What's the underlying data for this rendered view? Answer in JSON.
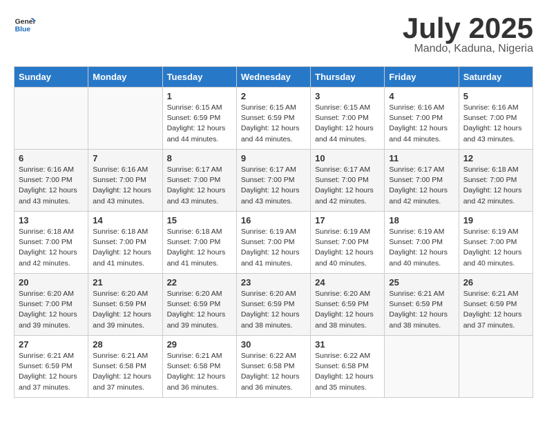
{
  "header": {
    "logo_general": "General",
    "logo_blue": "Blue",
    "month": "July 2025",
    "location": "Mando, Kaduna, Nigeria"
  },
  "days_of_week": [
    "Sunday",
    "Monday",
    "Tuesday",
    "Wednesday",
    "Thursday",
    "Friday",
    "Saturday"
  ],
  "weeks": [
    [
      {
        "day": "",
        "info": ""
      },
      {
        "day": "",
        "info": ""
      },
      {
        "day": "1",
        "info": "Sunrise: 6:15 AM\nSunset: 6:59 PM\nDaylight: 12 hours and 44 minutes."
      },
      {
        "day": "2",
        "info": "Sunrise: 6:15 AM\nSunset: 6:59 PM\nDaylight: 12 hours and 44 minutes."
      },
      {
        "day": "3",
        "info": "Sunrise: 6:15 AM\nSunset: 7:00 PM\nDaylight: 12 hours and 44 minutes."
      },
      {
        "day": "4",
        "info": "Sunrise: 6:16 AM\nSunset: 7:00 PM\nDaylight: 12 hours and 44 minutes."
      },
      {
        "day": "5",
        "info": "Sunrise: 6:16 AM\nSunset: 7:00 PM\nDaylight: 12 hours and 43 minutes."
      }
    ],
    [
      {
        "day": "6",
        "info": "Sunrise: 6:16 AM\nSunset: 7:00 PM\nDaylight: 12 hours and 43 minutes."
      },
      {
        "day": "7",
        "info": "Sunrise: 6:16 AM\nSunset: 7:00 PM\nDaylight: 12 hours and 43 minutes."
      },
      {
        "day": "8",
        "info": "Sunrise: 6:17 AM\nSunset: 7:00 PM\nDaylight: 12 hours and 43 minutes."
      },
      {
        "day": "9",
        "info": "Sunrise: 6:17 AM\nSunset: 7:00 PM\nDaylight: 12 hours and 43 minutes."
      },
      {
        "day": "10",
        "info": "Sunrise: 6:17 AM\nSunset: 7:00 PM\nDaylight: 12 hours and 42 minutes."
      },
      {
        "day": "11",
        "info": "Sunrise: 6:17 AM\nSunset: 7:00 PM\nDaylight: 12 hours and 42 minutes."
      },
      {
        "day": "12",
        "info": "Sunrise: 6:18 AM\nSunset: 7:00 PM\nDaylight: 12 hours and 42 minutes."
      }
    ],
    [
      {
        "day": "13",
        "info": "Sunrise: 6:18 AM\nSunset: 7:00 PM\nDaylight: 12 hours and 42 minutes."
      },
      {
        "day": "14",
        "info": "Sunrise: 6:18 AM\nSunset: 7:00 PM\nDaylight: 12 hours and 41 minutes."
      },
      {
        "day": "15",
        "info": "Sunrise: 6:18 AM\nSunset: 7:00 PM\nDaylight: 12 hours and 41 minutes."
      },
      {
        "day": "16",
        "info": "Sunrise: 6:19 AM\nSunset: 7:00 PM\nDaylight: 12 hours and 41 minutes."
      },
      {
        "day": "17",
        "info": "Sunrise: 6:19 AM\nSunset: 7:00 PM\nDaylight: 12 hours and 40 minutes."
      },
      {
        "day": "18",
        "info": "Sunrise: 6:19 AM\nSunset: 7:00 PM\nDaylight: 12 hours and 40 minutes."
      },
      {
        "day": "19",
        "info": "Sunrise: 6:19 AM\nSunset: 7:00 PM\nDaylight: 12 hours and 40 minutes."
      }
    ],
    [
      {
        "day": "20",
        "info": "Sunrise: 6:20 AM\nSunset: 7:00 PM\nDaylight: 12 hours and 39 minutes."
      },
      {
        "day": "21",
        "info": "Sunrise: 6:20 AM\nSunset: 6:59 PM\nDaylight: 12 hours and 39 minutes."
      },
      {
        "day": "22",
        "info": "Sunrise: 6:20 AM\nSunset: 6:59 PM\nDaylight: 12 hours and 39 minutes."
      },
      {
        "day": "23",
        "info": "Sunrise: 6:20 AM\nSunset: 6:59 PM\nDaylight: 12 hours and 38 minutes."
      },
      {
        "day": "24",
        "info": "Sunrise: 6:20 AM\nSunset: 6:59 PM\nDaylight: 12 hours and 38 minutes."
      },
      {
        "day": "25",
        "info": "Sunrise: 6:21 AM\nSunset: 6:59 PM\nDaylight: 12 hours and 38 minutes."
      },
      {
        "day": "26",
        "info": "Sunrise: 6:21 AM\nSunset: 6:59 PM\nDaylight: 12 hours and 37 minutes."
      }
    ],
    [
      {
        "day": "27",
        "info": "Sunrise: 6:21 AM\nSunset: 6:59 PM\nDaylight: 12 hours and 37 minutes."
      },
      {
        "day": "28",
        "info": "Sunrise: 6:21 AM\nSunset: 6:58 PM\nDaylight: 12 hours and 37 minutes."
      },
      {
        "day": "29",
        "info": "Sunrise: 6:21 AM\nSunset: 6:58 PM\nDaylight: 12 hours and 36 minutes."
      },
      {
        "day": "30",
        "info": "Sunrise: 6:22 AM\nSunset: 6:58 PM\nDaylight: 12 hours and 36 minutes."
      },
      {
        "day": "31",
        "info": "Sunrise: 6:22 AM\nSunset: 6:58 PM\nDaylight: 12 hours and 35 minutes."
      },
      {
        "day": "",
        "info": ""
      },
      {
        "day": "",
        "info": ""
      }
    ]
  ]
}
